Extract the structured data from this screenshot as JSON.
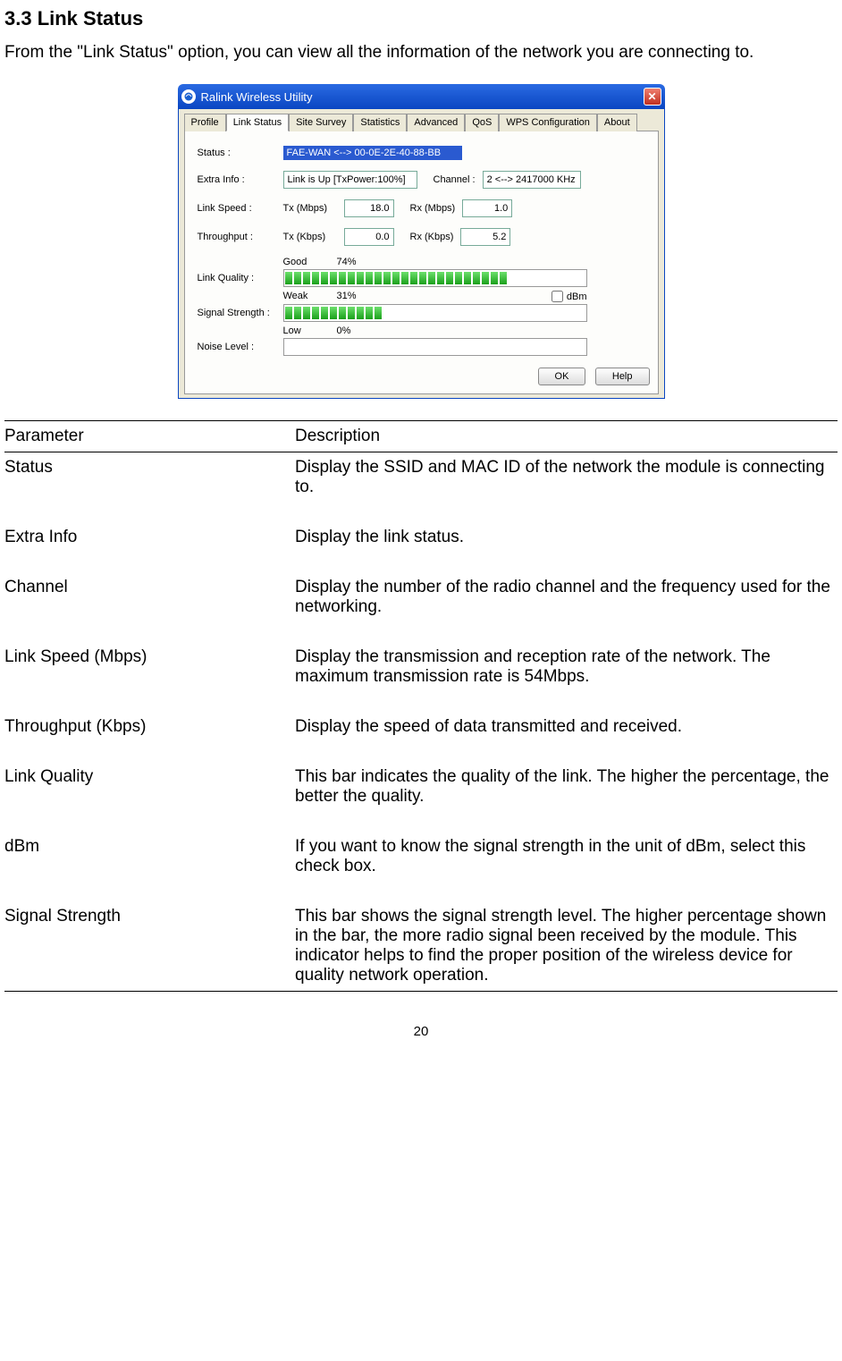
{
  "heading": "3.3   Link Status",
  "intro": "From the \"Link Status\" option, you can view all the information of the network you are connecting to.",
  "window": {
    "title": "Ralink Wireless Utility",
    "tabs": [
      "Profile",
      "Link Status",
      "Site Survey",
      "Statistics",
      "Advanced",
      "QoS",
      "WPS Configuration",
      "About"
    ],
    "active_tab_index": 1,
    "labels": {
      "status": "Status :",
      "extra_info": "Extra Info :",
      "link_speed": "Link Speed :",
      "throughput": "Throughput :",
      "link_quality": "Link Quality :",
      "signal_strength": "Signal Strength :",
      "noise_level": "Noise Level :",
      "channel": "Channel :",
      "tx_mbps": "Tx (Mbps)",
      "rx_mbps": "Rx (Mbps)",
      "tx_kbps": "Tx (Kbps)",
      "rx_kbps": "Rx (Kbps)",
      "good": "Good",
      "weak": "Weak",
      "low": "Low",
      "dbm": "dBm"
    },
    "values": {
      "status": "FAE-WAN <--> 00-0E-2E-40-88-BB",
      "extra_info": "Link is Up [TxPower:100%]",
      "channel": "2 <--> 2417000 KHz",
      "tx_mbps": "18.0",
      "rx_mbps": "1.0",
      "tx_kbps": "0.0",
      "rx_kbps": "5.2",
      "link_quality_pct": "74%",
      "signal_strength_pct": "31%",
      "noise_level_pct": "0%"
    },
    "buttons": {
      "ok": "OK",
      "help": "Help"
    }
  },
  "table": {
    "header_param": "Parameter",
    "header_desc": "Description",
    "rows": [
      {
        "param": "Status",
        "desc": "Display the SSID and MAC ID of the network the module is connecting to."
      },
      {
        "param": "Extra Info",
        "desc": "Display the link status."
      },
      {
        "param": "Channel",
        "desc": "Display the number of the radio channel and the frequency used for the networking."
      },
      {
        "param": "Link Speed (Mbps)",
        "desc": "Display the transmission and reception rate of the network. The maximum transmission rate is 54Mbps."
      },
      {
        "param": "Throughput (Kbps)",
        "desc": "Display the speed of data transmitted and received."
      },
      {
        "param": "Link Quality",
        "desc": "This bar indicates the quality of the link. The higher the percentage, the better the quality."
      },
      {
        "param": "dBm",
        "desc": "If you want to know the signal strength in the unit of dBm, select this check box."
      },
      {
        "param": "Signal Strength",
        "desc": "This bar shows the signal strength level. The higher percentage shown in the bar, the more radio signal been received by the module. This indicator helps to find the proper position of the wireless device for quality network operation."
      }
    ]
  },
  "page_number": "20"
}
